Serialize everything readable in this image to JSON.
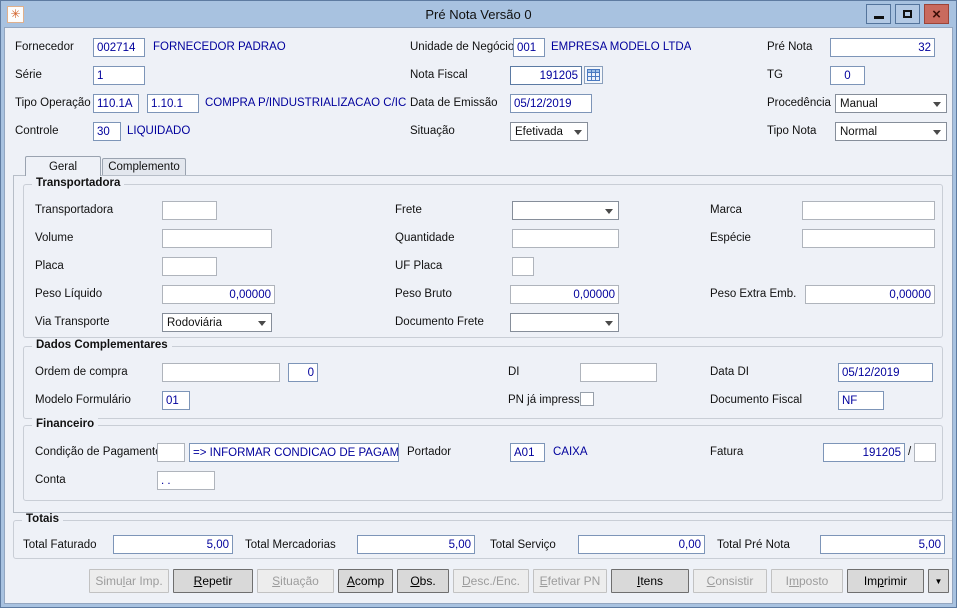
{
  "window": {
    "title": "Pré Nota Versão 0"
  },
  "icons": {
    "app": "✳",
    "close": "×"
  },
  "colors": {
    "titlebar": "#a8c2e0",
    "window_bg": "#eef1f7",
    "value_text": "#00009c",
    "close_button": "#c96a5e"
  },
  "header": {
    "fornecedor": {
      "label": "Fornecedor",
      "code": "002714",
      "name": "FORNECEDOR PADRÃO"
    },
    "unidade": {
      "label": "Unidade de Negócio",
      "code": "001",
      "name": "EMPRESA MODELO LTDA"
    },
    "pre_nota": {
      "label": "Pré Nota",
      "value": "32"
    },
    "serie": {
      "label": "Série",
      "value": "1"
    },
    "nota_fiscal": {
      "label": "Nota Fiscal",
      "value": "191205"
    },
    "tg": {
      "label": "TG",
      "value": "0"
    },
    "tipo_operacao": {
      "label": "Tipo Operação",
      "code1": "110.1A",
      "code2": "1.10.1",
      "desc": "COMPRA P/INDUSTRIALIZACAO C/ICMS C"
    },
    "data_emissao": {
      "label": "Data de Emissão",
      "value": "05/12/2019"
    },
    "procedencia": {
      "label": "Procedência",
      "value": "Manual"
    },
    "controle": {
      "label": "Controle",
      "code": "30",
      "desc": "LIQUIDADO"
    },
    "situacao": {
      "label": "Situação",
      "value": "Efetivada"
    },
    "tipo_nota": {
      "label": "Tipo Nota",
      "value": "Normal"
    }
  },
  "tabs": {
    "geral": "Geral",
    "complemento": "Complemento"
  },
  "transportadora": {
    "title": "Transportadora",
    "transportadora_label": "Transportadora",
    "frete_label": "Frete",
    "marca_label": "Marca",
    "volume_label": "Volume",
    "quantidade_label": "Quantidade",
    "especie_label": "Espécie",
    "placa_label": "Placa",
    "uf_placa_label": "UF Placa",
    "peso_liquido": {
      "label": "Peso Líquido",
      "value": "0,00000"
    },
    "peso_bruto": {
      "label": "Peso Bruto",
      "value": "0,00000"
    },
    "peso_extra": {
      "label": "Peso Extra Emb.",
      "value": "0,00000"
    },
    "via_transporte": {
      "label": "Via Transporte",
      "value": "Rodoviária"
    },
    "documento_frete_label": "Documento Frete"
  },
  "dados_complementares": {
    "title": "Dados Complementares",
    "ordem_compra": {
      "label": "Ordem de compra",
      "value": "",
      "seq": "0"
    },
    "di_label": "DI",
    "data_di": {
      "label": "Data DI",
      "value": "05/12/2019"
    },
    "modelo_formulario": {
      "label": "Modelo Formulário",
      "value": "01"
    },
    "pn_impressa_label": "PN já impressa",
    "documento_fiscal": {
      "label": "Documento Fiscal",
      "value": "NF"
    }
  },
  "financeiro": {
    "title": "Financeiro",
    "condicao_pagamento": {
      "label": "Condição de Pagamento",
      "code": "",
      "desc": "=> INFORMAR CONDICAO DE PAGAMENTO"
    },
    "portador": {
      "label": "Portador",
      "code": "A01",
      "name": "CAIXA"
    },
    "fatura": {
      "label": "Fatura",
      "value": "191205",
      "sep": "/",
      "parcela": ""
    },
    "conta": {
      "label": "Conta",
      "value": ". ."
    }
  },
  "totais": {
    "title": "Totais",
    "total_faturado": {
      "label": "Total Faturado",
      "value": "5,00"
    },
    "total_mercadorias": {
      "label": "Total Mercadorias",
      "value": "5,00"
    },
    "total_servico": {
      "label": "Total Serviço",
      "value": "0,00"
    },
    "total_pre_nota": {
      "label": "Total Pré Nota",
      "value": "5,00"
    }
  },
  "buttons": {
    "items": [
      {
        "pre": "Simu",
        "key": "l",
        "post": "ar Imp.",
        "enabled": false
      },
      {
        "pre": "",
        "key": "R",
        "post": "epetir",
        "enabled": true
      },
      {
        "pre": "",
        "key": "S",
        "post": "ituação",
        "enabled": false
      },
      {
        "pre": "",
        "key": "A",
        "post": "comp",
        "enabled": true
      },
      {
        "pre": "",
        "key": "O",
        "post": "bs.",
        "enabled": true
      },
      {
        "pre": "",
        "key": "D",
        "post": "esc./Enc.",
        "enabled": false
      },
      {
        "pre": "",
        "key": "E",
        "post": "fetivar PN",
        "enabled": false
      },
      {
        "pre": "",
        "key": "I",
        "post": "tens",
        "enabled": true
      },
      {
        "pre": "",
        "key": "C",
        "post": "onsistir",
        "enabled": false
      },
      {
        "pre": "I",
        "key": "m",
        "post": "posto",
        "enabled": false
      },
      {
        "pre": "Im",
        "key": "p",
        "post": "rimir",
        "enabled": true
      }
    ],
    "more": "▼"
  }
}
